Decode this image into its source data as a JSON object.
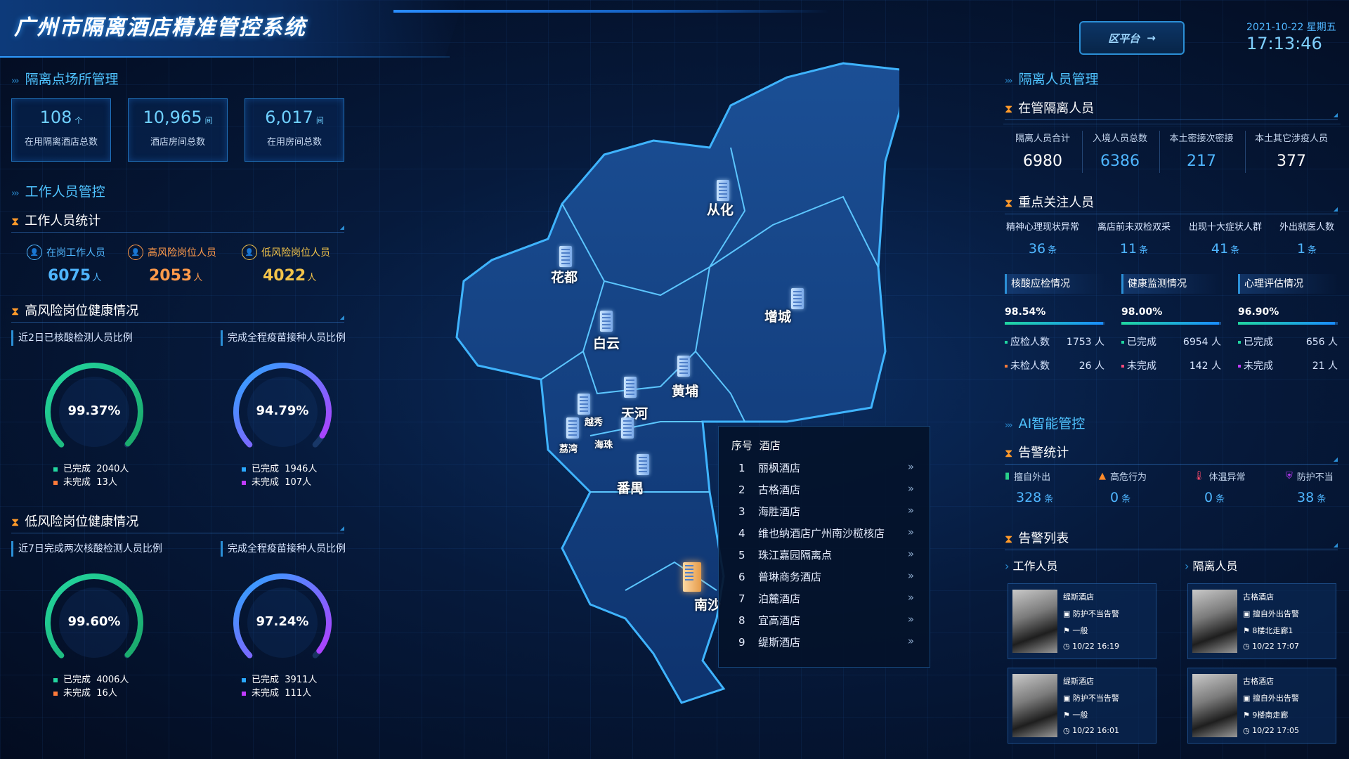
{
  "header": {
    "title": "广州市隔离酒店精准管控系统",
    "platform_btn": "区平台",
    "date": "2021-10-22 星期五",
    "time": "17:13:46"
  },
  "venue": {
    "heading": "隔离点场所管理",
    "stats": [
      {
        "value": "108",
        "unit": "个",
        "label": "在用隔离酒店总数"
      },
      {
        "value": "10,965",
        "unit": "间",
        "label": "酒店房间总数"
      },
      {
        "value": "6,017",
        "unit": "间",
        "label": "在用房间总数"
      }
    ]
  },
  "staff": {
    "heading": "工作人员管控",
    "stats_heading": "工作人员统计",
    "items": [
      {
        "label": "在岗工作人员",
        "value": "6075",
        "unit": "人",
        "color": "#4fb6ff"
      },
      {
        "label": "高风险岗位人员",
        "value": "2053",
        "unit": "人",
        "color": "#ff9a4a"
      },
      {
        "label": "低风险岗位人员",
        "value": "4022",
        "unit": "人",
        "color": "#f3c44a"
      }
    ],
    "high_heading": "高风险岗位健康情况",
    "low_heading": "低风险岗位健康情况",
    "gauges": [
      {
        "title": "近2日已核酸检测人员比例",
        "pct": "99.37%",
        "ratio": 0.9937,
        "done": "2040人",
        "undone": "13人",
        "c1": "#23d7a0",
        "c2": "#1aa86a",
        "undone_color": "#ff7a3a"
      },
      {
        "title": "完成全程疫苗接种人员比例",
        "pct": "94.79%",
        "ratio": 0.9479,
        "done": "1946人",
        "undone": "107人",
        "c1": "#2aa8ff",
        "c2": "#b43bff",
        "undone_color": "#c03cff"
      },
      {
        "title": "近7日完成两次核酸检测人员比例",
        "pct": "99.60%",
        "ratio": 0.996,
        "done": "4006人",
        "undone": "16人",
        "c1": "#23d7a0",
        "c2": "#1aa86a",
        "undone_color": "#ff7a3a"
      },
      {
        "title": "完成全程疫苗接种人员比例",
        "pct": "97.24%",
        "ratio": 0.9724,
        "done": "3911人",
        "undone": "111人",
        "c1": "#2aa8ff",
        "c2": "#b43bff",
        "undone_color": "#c03cff"
      }
    ],
    "done_label": "已完成",
    "undone_label": "未完成"
  },
  "map": {
    "districts": [
      "从化",
      "花都",
      "白云",
      "增城",
      "黄埔",
      "天河",
      "越秀",
      "荔湾",
      "海珠",
      "番禺",
      "南沙"
    ]
  },
  "hotels": {
    "head_no": "序号",
    "head_name": "酒店",
    "rows": [
      {
        "no": "1",
        "name": "丽枫酒店"
      },
      {
        "no": "2",
        "name": "古格酒店"
      },
      {
        "no": "3",
        "name": "海胜酒店"
      },
      {
        "no": "4",
        "name": "维也纳酒店广州南沙榄核店"
      },
      {
        "no": "5",
        "name": "珠江嘉园隔离点"
      },
      {
        "no": "6",
        "name": "普琳商务酒店"
      },
      {
        "no": "7",
        "name": "泊麓酒店"
      },
      {
        "no": "8",
        "name": "宜高酒店"
      },
      {
        "no": "9",
        "name": "缇斯酒店"
      }
    ],
    "arrow": "»"
  },
  "isolation": {
    "heading": "隔离人员管理",
    "sub": "在管隔离人员",
    "cols": [
      {
        "label": "隔离人员合计",
        "value": "6980",
        "color": "#ffffff"
      },
      {
        "label": "入境人员总数",
        "value": "6386",
        "color": "#4fb6ff"
      },
      {
        "label": "本土密接次密接",
        "value": "217",
        "color": "#4fb6ff"
      },
      {
        "label": "本土其它涉疫人员",
        "value": "377",
        "color": "#ffffff"
      }
    ],
    "focus_sub": "重点关注人员",
    "focus": [
      {
        "label": "精神心理现状异常",
        "value": "36",
        "unit": "条"
      },
      {
        "label": "离店前未双检双采",
        "value": "11",
        "unit": "条"
      },
      {
        "label": "出现十大症状人群",
        "value": "41",
        "unit": "条"
      },
      {
        "label": "外出就医人数",
        "value": "1",
        "unit": "条"
      }
    ],
    "progress": [
      {
        "title": "核酸应检情况",
        "pct": "98.54%",
        "ratio": 0.9854,
        "fill": "#20d6a0",
        "k1": "应检人数",
        "v1": "1753 人",
        "k2": "未检人数",
        "v2": "26 人",
        "c1": "#20d6a0",
        "c2": "#ff7a3a"
      },
      {
        "title": "健康监测情况",
        "pct": "98.00%",
        "ratio": 0.98,
        "fill": "#20d6a0",
        "k1": "已完成",
        "v1": "6954 人",
        "k2": "未完成",
        "v2": "142 人",
        "c1": "#20d6a0",
        "c2": "#ff4a7a"
      },
      {
        "title": "心理评估情况",
        "pct": "96.90%",
        "ratio": 0.969,
        "fill": "#20d6a0",
        "k1": "已完成",
        "v1": "656 人",
        "k2": "未完成",
        "v2": "21 人",
        "c1": "#20d6a0",
        "c2": "#c03cff"
      }
    ]
  },
  "ai": {
    "heading": "AI智能管控",
    "alarm_sub": "告警统计",
    "alarms": [
      {
        "label": "擅自外出",
        "value": "328",
        "unit": "条",
        "icon": "door-icon",
        "icolor": "#2ad08a"
      },
      {
        "label": "高危行为",
        "value": "0",
        "unit": "条",
        "icon": "warning-icon",
        "icolor": "#ff8a2a"
      },
      {
        "label": "体温异常",
        "value": "0",
        "unit": "条",
        "icon": "thermometer-icon",
        "icolor": "#ff4a6a"
      },
      {
        "label": "防护不当",
        "value": "38",
        "unit": "条",
        "icon": "shield-icon",
        "icolor": "#c03cff"
      }
    ],
    "list_sub": "告警列表",
    "staff_col": "工作人员",
    "iso_col": "隔离人员",
    "cards": [
      {
        "hotel": "缇斯酒店",
        "type": "防护不当告警",
        "level": "一般",
        "time": "10/22 16:19"
      },
      {
        "hotel": "古格酒店",
        "type": "擅自外出告警",
        "level": "8楼北走廊1",
        "time": "10/22 17:07"
      },
      {
        "hotel": "缇斯酒店",
        "type": "防护不当告警",
        "level": "一般",
        "time": "10/22 16:01"
      },
      {
        "hotel": "古格酒店",
        "type": "擅自外出告警",
        "level": "9楼南走廊",
        "time": "10/22 17:05"
      }
    ]
  }
}
